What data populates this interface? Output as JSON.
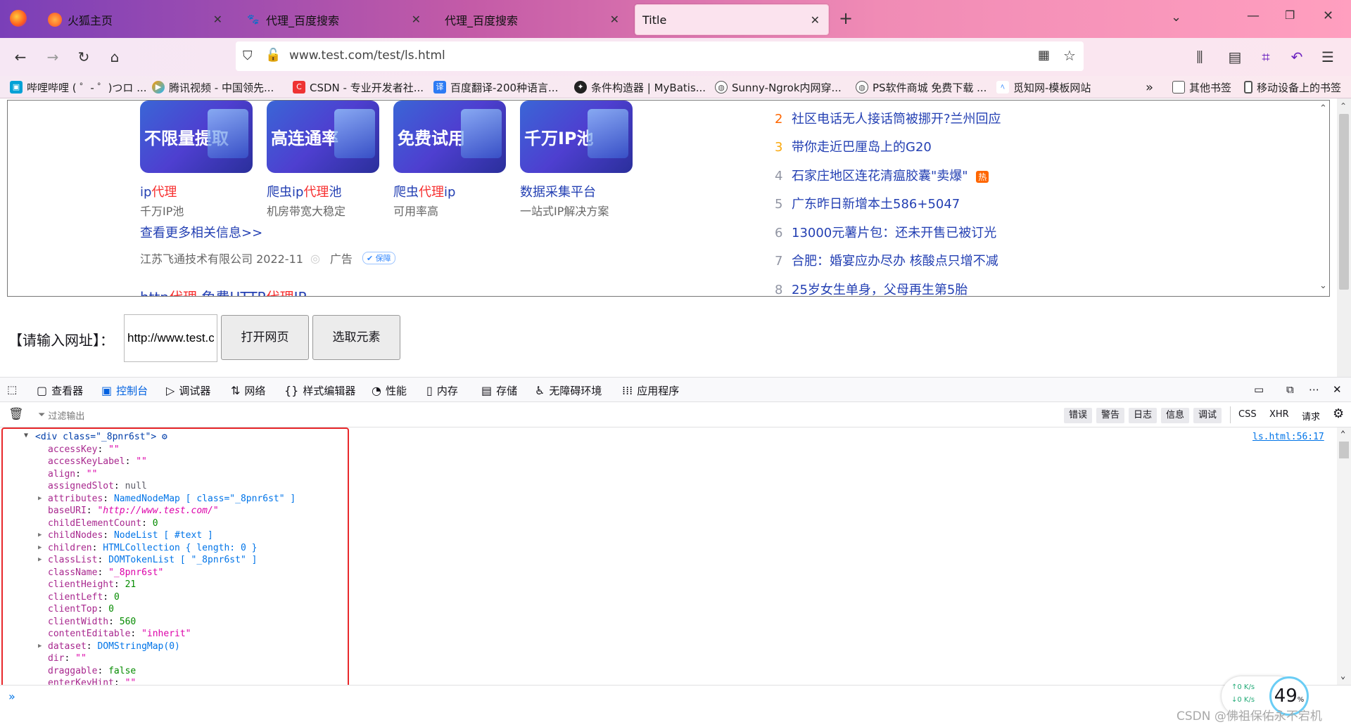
{
  "tabs": [
    {
      "label": "火狐主页"
    },
    {
      "label": "代理_百度搜索"
    },
    {
      "label": "代理_百度搜索"
    },
    {
      "label": "Title"
    }
  ],
  "url": "www.test.com/test/ls.html",
  "bookmarks": [
    {
      "label": "哔哩哔哩 ( ゜- ゜)つロ ...",
      "color": "#00a1d6"
    },
    {
      "label": "腾讯视频 - 中国领先...",
      "color": "#1fb6ff"
    },
    {
      "label": "CSDN - 专业开发者社...",
      "color": "#e33"
    },
    {
      "label": "百度翻译-200种语言...",
      "color": "#2d7bf4"
    },
    {
      "label": "条件构造器 | MyBatis...",
      "color": "#222"
    },
    {
      "label": "Sunny-Ngrok内网穿...",
      "color": "#555"
    },
    {
      "label": "PS软件商城 免费下载 ...",
      "color": "#555"
    },
    {
      "label": "觅知网-模板网站",
      "color": "#3a8cff"
    },
    {
      "label": "其他书签",
      "color": "#555"
    },
    {
      "label": "移动设备上的书签",
      "color": "#555"
    }
  ],
  "cards": [
    {
      "img": "不限量提取",
      "title_a": "ip",
      "title_b": "代理",
      "title_c": "",
      "sub": "千万IP池"
    },
    {
      "img": "高连通率",
      "title_a": "爬虫ip",
      "title_b": "代理",
      "title_c": "池",
      "sub": "机房带宽大稳定"
    },
    {
      "img": "免费试用",
      "title_a": "爬虫",
      "title_b": "代理",
      "title_c": "ip",
      "sub": "可用率高"
    },
    {
      "img": "千万IP池",
      "title_a": "数据采集平台",
      "title_b": "",
      "title_c": "",
      "sub": "一站式IP解决方案"
    }
  ],
  "more_info": "查看更多相关信息>>",
  "company": "江苏飞通技术有限公司 2022-11",
  "ad_label": "广告",
  "verified": "保障",
  "next_result_a": "http",
  "next_result_b": "代理",
  "next_result_c": " 免费HTTP",
  "next_result_d": "代理",
  "next_result_e": "IP",
  "hot_list": [
    {
      "num": "2",
      "text": "社区电话无人接话筒被挪开?兰州回应",
      "color": "#ff6600"
    },
    {
      "num": "3",
      "text": "带你走近巴厘岛上的G20",
      "color": "#faa90e"
    },
    {
      "num": "4",
      "text": "石家庄地区连花清瘟胶囊\"卖爆\"",
      "color": "#9195a3",
      "badge": "热"
    },
    {
      "num": "5",
      "text": "广东昨日新增本土586+5047",
      "color": "#9195a3"
    },
    {
      "num": "6",
      "text": "13000元薯片包：还未开售已被订光",
      "color": "#9195a3"
    },
    {
      "num": "7",
      "text": "合肥：婚宴应办尽办 核酸点只增不减",
      "color": "#9195a3"
    },
    {
      "num": "8",
      "text": "25岁女生单身，父母再生第5胎",
      "color": "#9195a3"
    }
  ],
  "form": {
    "label": "【请输入网址】：",
    "input_value": "http://www.test.com/test/",
    "open_button": "打开网页",
    "pick_button": "选取元素"
  },
  "devtools": {
    "tabs": [
      "查看器",
      "控制台",
      "调试器",
      "网络",
      "样式编辑器",
      "性能",
      "内存",
      "存储",
      "无障碍环境",
      "应用程序"
    ],
    "filter_placeholder": "过滤输出",
    "levels": [
      "错误",
      "警告",
      "日志",
      "信息",
      "调试"
    ],
    "types": [
      "CSS",
      "XHR",
      "请求"
    ],
    "source": "ls.html:56:17"
  },
  "console_lines": [
    {
      "key": "<div class=\"_8pnr6st\">",
      "val": "",
      "kind": "root"
    },
    {
      "key": "accessKey",
      "val": "\"\"",
      "kind": "s"
    },
    {
      "key": "accessKeyLabel",
      "val": "\"\"",
      "kind": "s"
    },
    {
      "key": "align",
      "val": "\"\"",
      "kind": "s"
    },
    {
      "key": "assignedSlot",
      "val": "null",
      "kind": "g"
    },
    {
      "key": "attributes",
      "val": "NamedNodeMap [ class=\"_8pnr6st\" ]",
      "kind": "k",
      "twisty": true
    },
    {
      "key": "baseURI",
      "val": "\"http://www.test.com/\"",
      "kind": "u"
    },
    {
      "key": "childElementCount",
      "val": "0",
      "kind": "n"
    },
    {
      "key": "childNodes",
      "val": "NodeList [ #text ]",
      "kind": "k",
      "twisty": true
    },
    {
      "key": "children",
      "val": "HTMLCollection { length: 0 }",
      "kind": "k",
      "twisty": true
    },
    {
      "key": "classList",
      "val": "DOMTokenList [ \"_8pnr6st\" ]",
      "kind": "k",
      "twisty": true
    },
    {
      "key": "className",
      "val": "\"_8pnr6st\"",
      "kind": "s"
    },
    {
      "key": "clientHeight",
      "val": "21",
      "kind": "n"
    },
    {
      "key": "clientLeft",
      "val": "0",
      "kind": "n"
    },
    {
      "key": "clientTop",
      "val": "0",
      "kind": "n"
    },
    {
      "key": "clientWidth",
      "val": "560",
      "kind": "n"
    },
    {
      "key": "contentEditable",
      "val": "\"inherit\"",
      "kind": "s"
    },
    {
      "key": "dataset",
      "val": "DOMStringMap(0)",
      "kind": "k",
      "twisty": true
    },
    {
      "key": "dir",
      "val": "\"\"",
      "kind": "s"
    },
    {
      "key": "draggable",
      "val": "false",
      "kind": "n"
    },
    {
      "key": "enterKeyHint",
      "val": "\"\"",
      "kind": "s"
    }
  ],
  "net_speed": {
    "up": "0 K/s",
    "down": "0 K/s",
    "percent": "49",
    "unit": "%"
  },
  "watermark": "CSDN @佛祖保佑永不宕机"
}
